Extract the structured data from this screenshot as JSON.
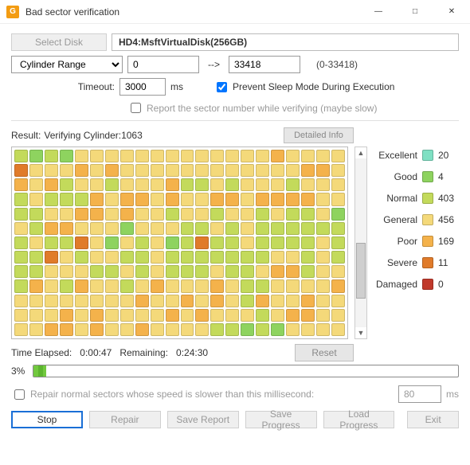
{
  "window": {
    "title": "Bad sector verification"
  },
  "top": {
    "select_disk_btn": "Select Disk",
    "disk_name": "HD4:MsftVirtualDisk(256GB)"
  },
  "range": {
    "mode_label": "Cylinder Range",
    "from": "0",
    "arrow": "-->",
    "to": "33418",
    "hint": "(0-33418)"
  },
  "timeout": {
    "label": "Timeout:",
    "value": "3000",
    "unit": "ms",
    "prevent_sleep_label": "Prevent Sleep Mode During Execution",
    "prevent_sleep_checked": true,
    "report_sector_label": "Report the sector number while verifying (maybe slow)",
    "report_sector_checked": false
  },
  "result": {
    "label": "Result:",
    "status": "Verifying Cylinder:1063",
    "detailed_info_btn": "Detailed Info"
  },
  "legend": [
    {
      "name": "Excellent",
      "cls": "c-exc",
      "count": 20
    },
    {
      "name": "Good",
      "cls": "c-good",
      "count": 4
    },
    {
      "name": "Normal",
      "cls": "c-norm",
      "count": 403
    },
    {
      "name": "General",
      "cls": "c-gen",
      "count": 456
    },
    {
      "name": "Poor",
      "cls": "c-poor",
      "count": 169
    },
    {
      "name": "Severe",
      "cls": "c-sev",
      "count": 11
    },
    {
      "name": "Damaged",
      "cls": "c-dmg",
      "count": 0
    }
  ],
  "grid": {
    "cols": 22,
    "rows": 13,
    "cells": "NGNGGeGeGeGeGeGeGeGeGeGeGeGeGePGeGeGeGeSGeGeGePGePGeGeGeGeGeGeGeGeGeGeGeGePPGePGePNGeGeNGeGeGePNNGeNGeGeGeNGeGeGeNGeNNNPGePPGePGeGePPGePPPPGeGeNNGeGePPGePGeGeNGeGeNGeGeNGeNNGeGGeNPPGeGeGeGGeGeGeNNGeNGeNNNNNNNGeNNSGeGGeNGeGNSNNGeNNNNGeNNNSGeNGeGeNNGeNNNNNNNGeGeNGeNNNGeGeGeNNGeNGeNNNGeNNGePPNGeGeNPGeNPGeGeNGePGeGeGePGeNNGeGeGeGePGeGeGeGeGeGeGeGePGeGePGePGeNPGeGePGeGeGeGeGePGePGeGeGeGePGePGeGeGeNGePPGeGeGeGePPGePGeGePGeGeGeGeN"
  },
  "time": {
    "elapsed_label": "Time Elapsed:",
    "elapsed_value": "0:00:47",
    "remaining_label": "Remaining:",
    "remaining_value": "0:24:30",
    "reset_btn": "Reset"
  },
  "progress": {
    "percent_label": "3%",
    "percent": 3
  },
  "repair": {
    "checkbox_label": "Repair normal sectors whose speed is slower than this millisecond:",
    "ms_value": "80",
    "ms_unit": "ms"
  },
  "buttons": {
    "stop": "Stop",
    "repair": "Repair",
    "save_report": "Save Report",
    "save_progress": "Save Progress",
    "load_progress": "Load Progress",
    "exit": "Exit"
  }
}
